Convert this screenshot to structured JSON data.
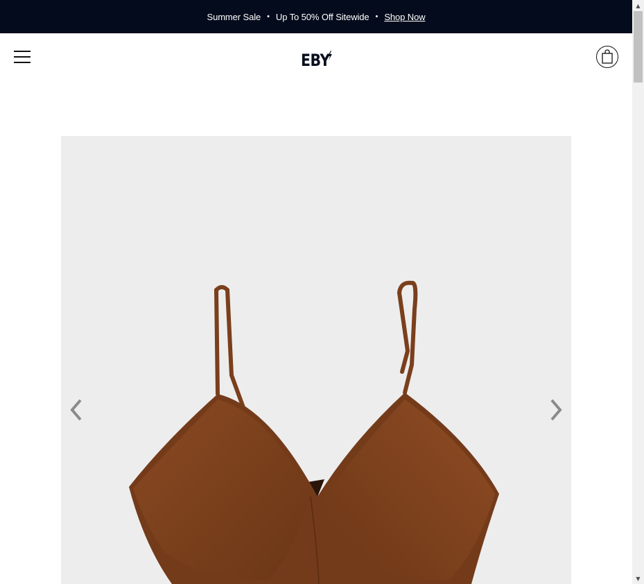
{
  "announcement": {
    "item1": "Summer Sale",
    "separator": "•",
    "item2": "Up To 50% Off Sitewide",
    "link": "Shop Now"
  },
  "header": {
    "logo_text": "EBY",
    "menu_icon": "hamburger-menu-icon",
    "cart_icon": "shopping-bag-icon"
  },
  "gallery": {
    "image_alt": "Brown seamless bodysuit with adjustable straps",
    "prev_icon": "chevron-left-icon",
    "next_icon": "chevron-right-icon",
    "background_color": "#ededed",
    "product_color": "#7a3f1c"
  },
  "colors": {
    "announcement_bg": "#040b1c",
    "text": "#111111"
  }
}
